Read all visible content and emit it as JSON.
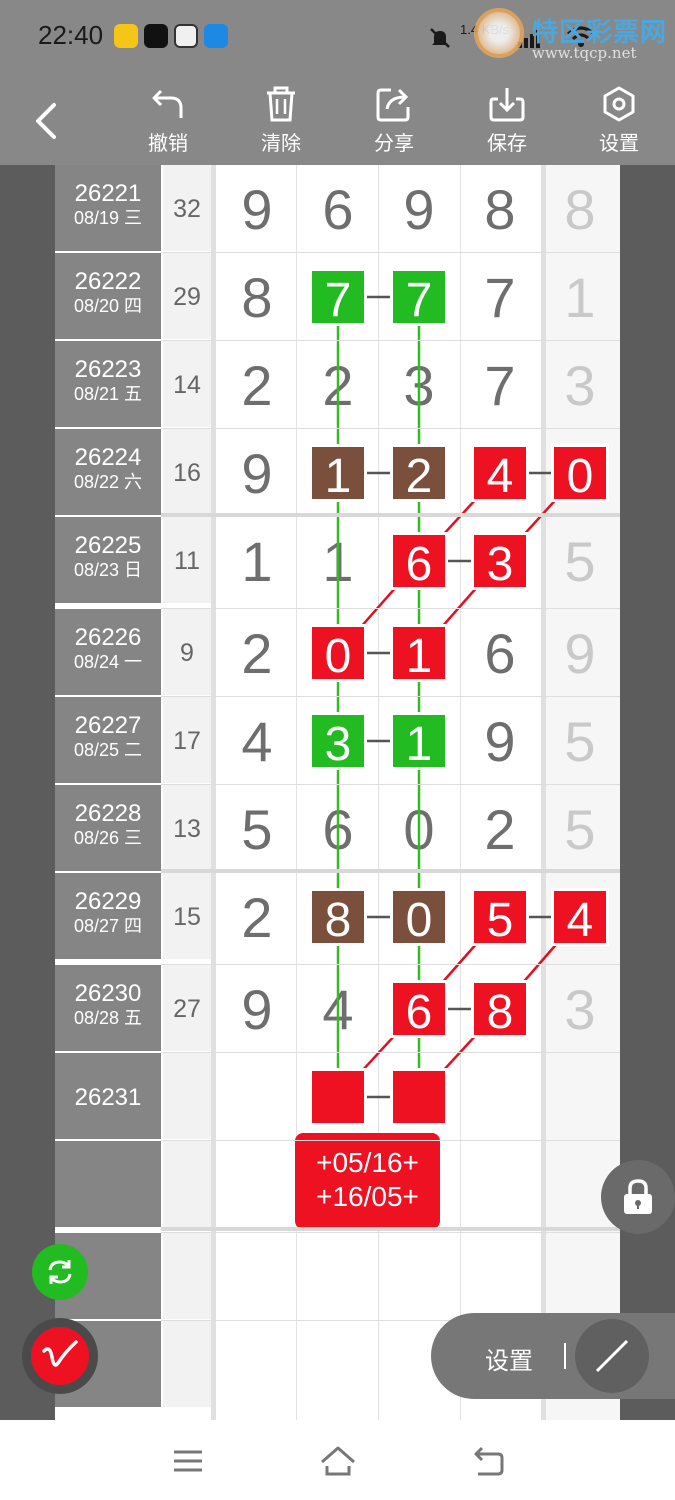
{
  "status_bar": {
    "time": "22:40",
    "network": "1.4 KB/s",
    "watermark_name": "特区彩票网",
    "watermark_url": "www.tqcp.net"
  },
  "toolbar": {
    "undo_label": "撤销",
    "clear_label": "清除",
    "share_label": "分享",
    "save_label": "保存",
    "settings_label": "设置"
  },
  "rows": [
    {
      "issue": "26221",
      "date": "08/19 三",
      "sum": "32",
      "digits": [
        "9",
        "6",
        "9",
        "8"
      ],
      "extra": "8"
    },
    {
      "issue": "26222",
      "date": "08/20 四",
      "sum": "29",
      "digits": [
        "8",
        "7",
        "7",
        "7"
      ],
      "extra": "1"
    },
    {
      "issue": "26223",
      "date": "08/21 五",
      "sum": "14",
      "digits": [
        "2",
        "2",
        "3",
        "7"
      ],
      "extra": "3"
    },
    {
      "issue": "26224",
      "date": "08/22 六",
      "sum": "16",
      "digits": [
        "9",
        "1",
        "2",
        "4"
      ],
      "extra": "0"
    },
    {
      "issue": "26225",
      "date": "08/23 日",
      "sum": "11",
      "digits": [
        "1",
        "1",
        "6",
        "3"
      ],
      "extra": "5"
    },
    {
      "issue": "26226",
      "date": "08/24 一",
      "sum": "9",
      "digits": [
        "2",
        "0",
        "1",
        "6"
      ],
      "extra": "9"
    },
    {
      "issue": "26227",
      "date": "08/25 二",
      "sum": "17",
      "digits": [
        "4",
        "3",
        "1",
        "9"
      ],
      "extra": "5"
    },
    {
      "issue": "26228",
      "date": "08/26 三",
      "sum": "13",
      "digits": [
        "5",
        "6",
        "0",
        "2"
      ],
      "extra": "5"
    },
    {
      "issue": "26229",
      "date": "08/27 四",
      "sum": "15",
      "digits": [
        "2",
        "8",
        "0",
        "5"
      ],
      "extra": "4"
    },
    {
      "issue": "26230",
      "date": "08/28 五",
      "sum": "27",
      "digits": [
        "9",
        "4",
        "6",
        "8"
      ],
      "extra": "3"
    },
    {
      "issue": "26231",
      "date": "",
      "sum": "",
      "digits": [
        "",
        "",
        "",
        ""
      ],
      "extra": ""
    },
    {
      "issue": "",
      "date": "",
      "sum": "",
      "digits": [
        "",
        "",
        "",
        ""
      ],
      "extra": ""
    },
    {
      "issue": "",
      "date": "",
      "sum": "",
      "digits": [
        "",
        "",
        "",
        ""
      ],
      "extra": ""
    },
    {
      "issue": "",
      "date": "",
      "sum": "",
      "digits": [
        "",
        "",
        "",
        ""
      ],
      "extra": ""
    }
  ],
  "marks": [
    {
      "row": 1,
      "col": 1,
      "color": "green",
      "text": "7"
    },
    {
      "row": 1,
      "col": 2,
      "color": "green",
      "text": "7"
    },
    {
      "row": 3,
      "col": 1,
      "color": "brown",
      "text": "1"
    },
    {
      "row": 3,
      "col": 2,
      "color": "brown",
      "text": "2"
    },
    {
      "row": 3,
      "col": 3,
      "color": "red",
      "text": "4"
    },
    {
      "row": 3,
      "col": 4,
      "color": "red",
      "text": "0"
    },
    {
      "row": 4,
      "col": 2,
      "color": "red",
      "text": "6"
    },
    {
      "row": 4,
      "col": 3,
      "color": "red",
      "text": "3"
    },
    {
      "row": 5,
      "col": 1,
      "color": "red",
      "text": "0"
    },
    {
      "row": 5,
      "col": 2,
      "color": "red",
      "text": "1"
    },
    {
      "row": 6,
      "col": 1,
      "color": "green",
      "text": "3"
    },
    {
      "row": 6,
      "col": 2,
      "color": "green",
      "text": "1"
    },
    {
      "row": 8,
      "col": 1,
      "color": "brown",
      "text": "8"
    },
    {
      "row": 8,
      "col": 2,
      "color": "brown",
      "text": "0"
    },
    {
      "row": 8,
      "col": 3,
      "color": "red",
      "text": "5"
    },
    {
      "row": 8,
      "col": 4,
      "color": "red",
      "text": "4"
    },
    {
      "row": 9,
      "col": 2,
      "color": "red",
      "text": "6"
    },
    {
      "row": 9,
      "col": 3,
      "color": "red",
      "text": "8"
    },
    {
      "row": 10,
      "col": 1,
      "color": "red",
      "text": ""
    },
    {
      "row": 10,
      "col": 2,
      "color": "red",
      "text": ""
    }
  ],
  "prediction": {
    "line1": "+05/16+",
    "line2": "+16/05+"
  },
  "bottom_controls": {
    "settings_label": "设置"
  },
  "colors": {
    "green": "#22bb22",
    "brown": "#7a4f3c",
    "red": "#ee1122",
    "green_line": "#33bb22",
    "red_line": "#e01020"
  }
}
